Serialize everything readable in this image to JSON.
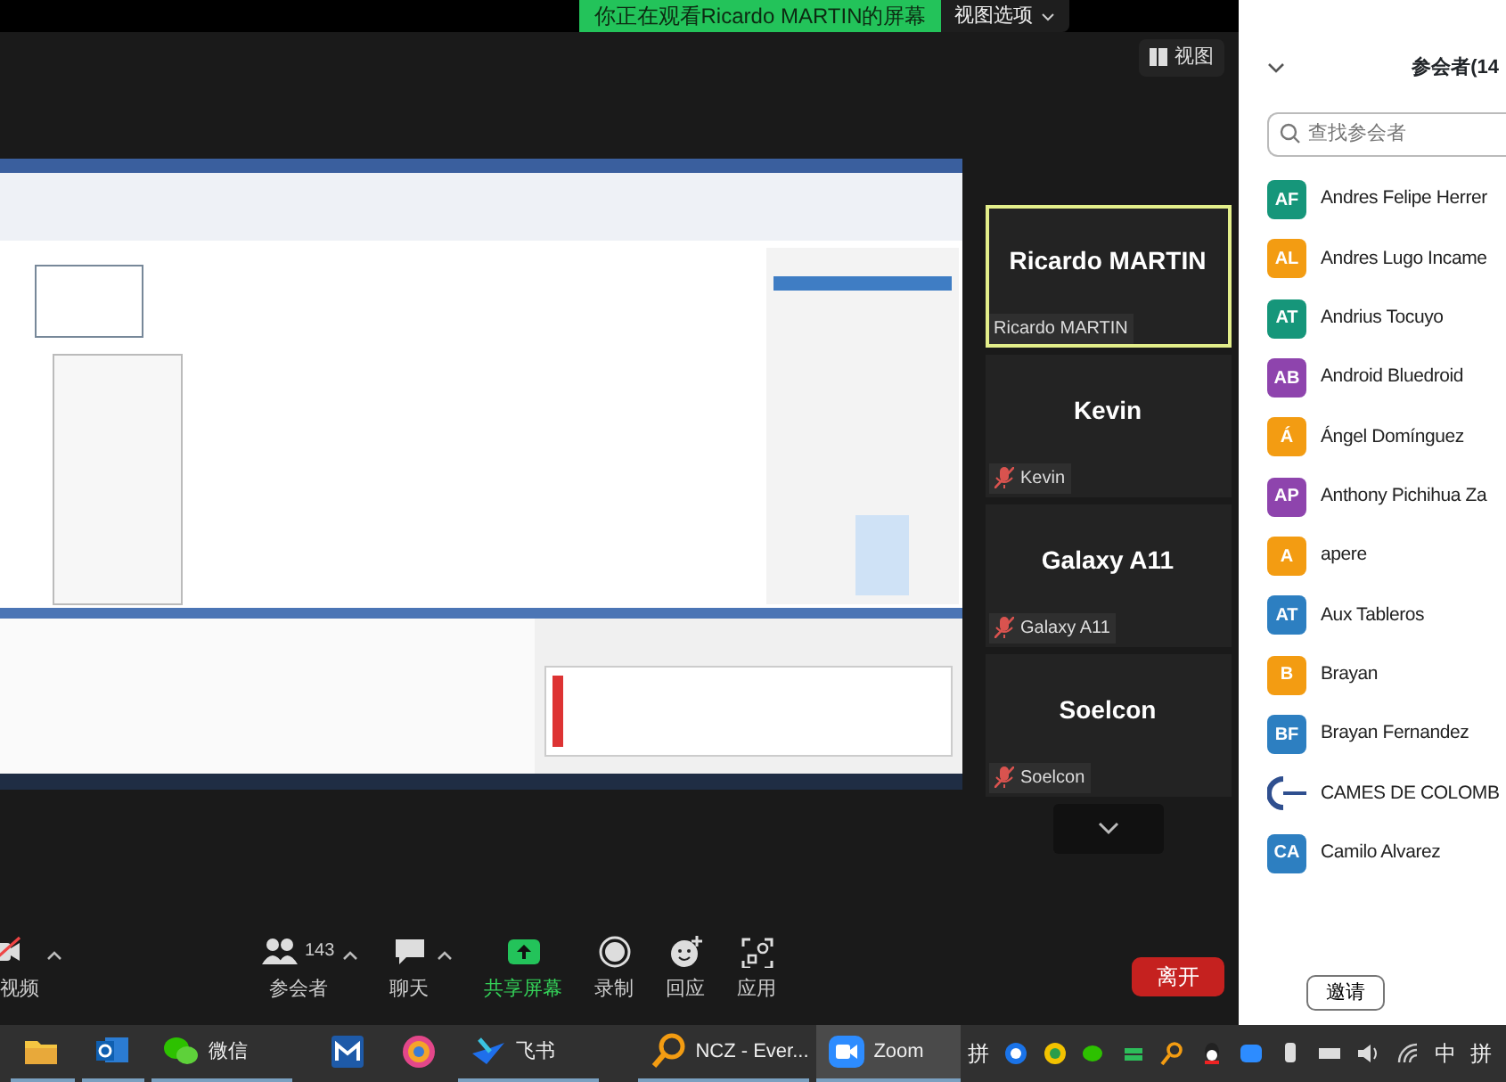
{
  "banner": {
    "text": "你正在观看Ricardo MARTIN的屏幕",
    "options": "视图选项"
  },
  "view_button": "视图",
  "tiles": [
    {
      "name": "Ricardo MARTIN",
      "label": "Ricardo MARTIN",
      "muted": false,
      "selected": true
    },
    {
      "name": "Kevin",
      "label": "Kevin",
      "muted": true,
      "selected": false
    },
    {
      "name": "Galaxy A11",
      "label": "Galaxy A11",
      "muted": true,
      "selected": false
    },
    {
      "name": "Soelcon",
      "label": "Soelcon",
      "muted": true,
      "selected": false
    }
  ],
  "toolbar": [
    {
      "kind": "video",
      "label": "视频",
      "caret": true
    },
    {
      "kind": "participants",
      "label": "参会者",
      "count": "143",
      "caret": true
    },
    {
      "kind": "chat",
      "label": "聊天",
      "caret": true
    },
    {
      "kind": "share",
      "label": "共享屏幕",
      "caret": false
    },
    {
      "kind": "record",
      "label": "录制",
      "caret": false
    },
    {
      "kind": "reactions",
      "label": "回应",
      "caret": false
    },
    {
      "kind": "apps",
      "label": "应用",
      "caret": false
    }
  ],
  "leave_button": "离开",
  "participants_panel": {
    "title": "参会者(14",
    "search": {
      "placeholder": "查找参会者"
    },
    "participants": [
      {
        "kind": "avatar",
        "initials": "AF",
        "name": "Andres Felipe Herrer",
        "color": "#16967a"
      },
      {
        "kind": "avatar",
        "initials": "AL",
        "name": "Andres Lugo Incame",
        "color": "#f39c12"
      },
      {
        "kind": "avatar",
        "initials": "AT",
        "name": "Andrius Tocuyo",
        "color": "#16967a"
      },
      {
        "kind": "avatar",
        "initials": "AB",
        "name": "Android Bluedroid",
        "color": "#8e44ad"
      },
      {
        "kind": "avatar",
        "initials": "Á",
        "name": "Ángel Domínguez",
        "color": "#f39c12"
      },
      {
        "kind": "avatar",
        "initials": "AP",
        "name": "Anthony Pichihua Za",
        "color": "#8e44ad"
      },
      {
        "kind": "avatar",
        "initials": "A",
        "name": "apere",
        "color": "#f39c12"
      },
      {
        "kind": "avatar",
        "initials": "AT",
        "name": "Aux Tableros",
        "color": "#2d7fc1"
      },
      {
        "kind": "avatar",
        "initials": "B",
        "name": "Brayan",
        "color": "#f39c12"
      },
      {
        "kind": "avatar",
        "initials": "BF",
        "name": "Brayan Fernandez",
        "color": "#2d7fc1"
      },
      {
        "kind": "logo",
        "name": "CAMES DE COLOMB"
      },
      {
        "kind": "avatar",
        "initials": "CA",
        "name": "Camilo Alvarez",
        "color": "#2d7fc1"
      }
    ],
    "invite_button": "邀请"
  },
  "taskbar": {
    "apps": [
      {
        "active": false
      },
      {
        "active": false
      },
      {
        "label": "微信",
        "active": false
      },
      {
        "active": false
      },
      {
        "active": false
      },
      {
        "label": "飞书",
        "active": false
      },
      {
        "label": "NCZ - Ever...",
        "active": false
      },
      {
        "label": "Zoom",
        "active": true
      }
    ],
    "tray_texts": [
      "拼",
      "中",
      "拼"
    ]
  }
}
